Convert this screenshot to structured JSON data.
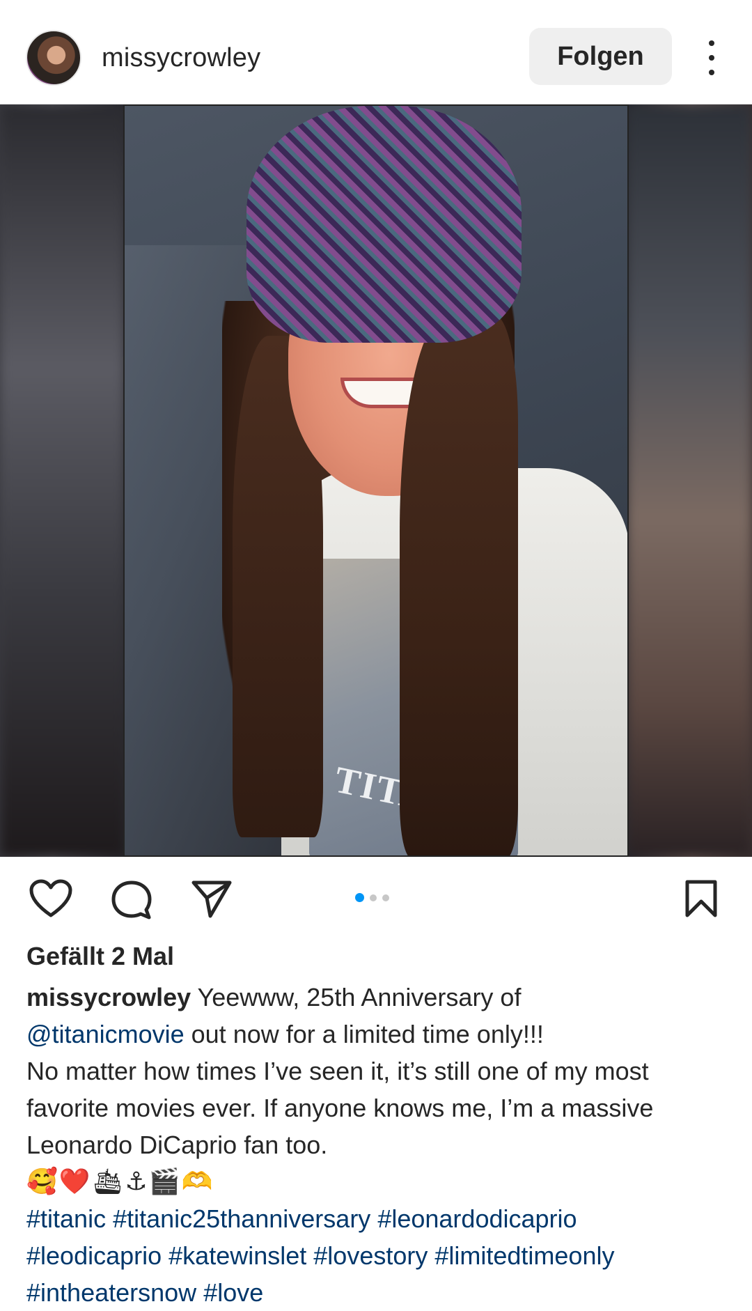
{
  "post": {
    "username": "missycrowley",
    "follow_label": "Folgen",
    "more_icon": "more-vertical-icon"
  },
  "media": {
    "shirt_text": "TITANIC",
    "carousel": {
      "count": 3,
      "active_index": 0
    }
  },
  "actions": {
    "icons": [
      "heart-icon",
      "comment-icon",
      "share-icon",
      "bookmark-icon"
    ],
    "accent_color": "#0095f6"
  },
  "likes": {
    "text": "Gefällt 2 Mal"
  },
  "caption": {
    "username": "missycrowley",
    "line1_text": "Yeewww, 25th Anniversary of",
    "mention": "@titanicmovie",
    "line2_rest": "out now for a limited time only!!!",
    "line3": "No matter how times I’ve seen it, it’s still one of my most",
    "line4": "favorite movies ever. If anyone knows me, I’m a massive",
    "line5": "Leonardo DiCaprio fan too.",
    "emojis": [
      "🥰",
      "❤️",
      "🛳",
      "⚓",
      "🎬",
      "🫶"
    ],
    "hashtags_line1": [
      "#titanic",
      "#titanic25thanniversary",
      "#leonardodicaprio"
    ],
    "hashtags_line2": [
      "#leodicaprio",
      "#katewinslet",
      "#lovestory",
      "#limitedtimeonly"
    ],
    "hashtags_line3": [
      "#intheatersnow",
      "#love"
    ]
  }
}
